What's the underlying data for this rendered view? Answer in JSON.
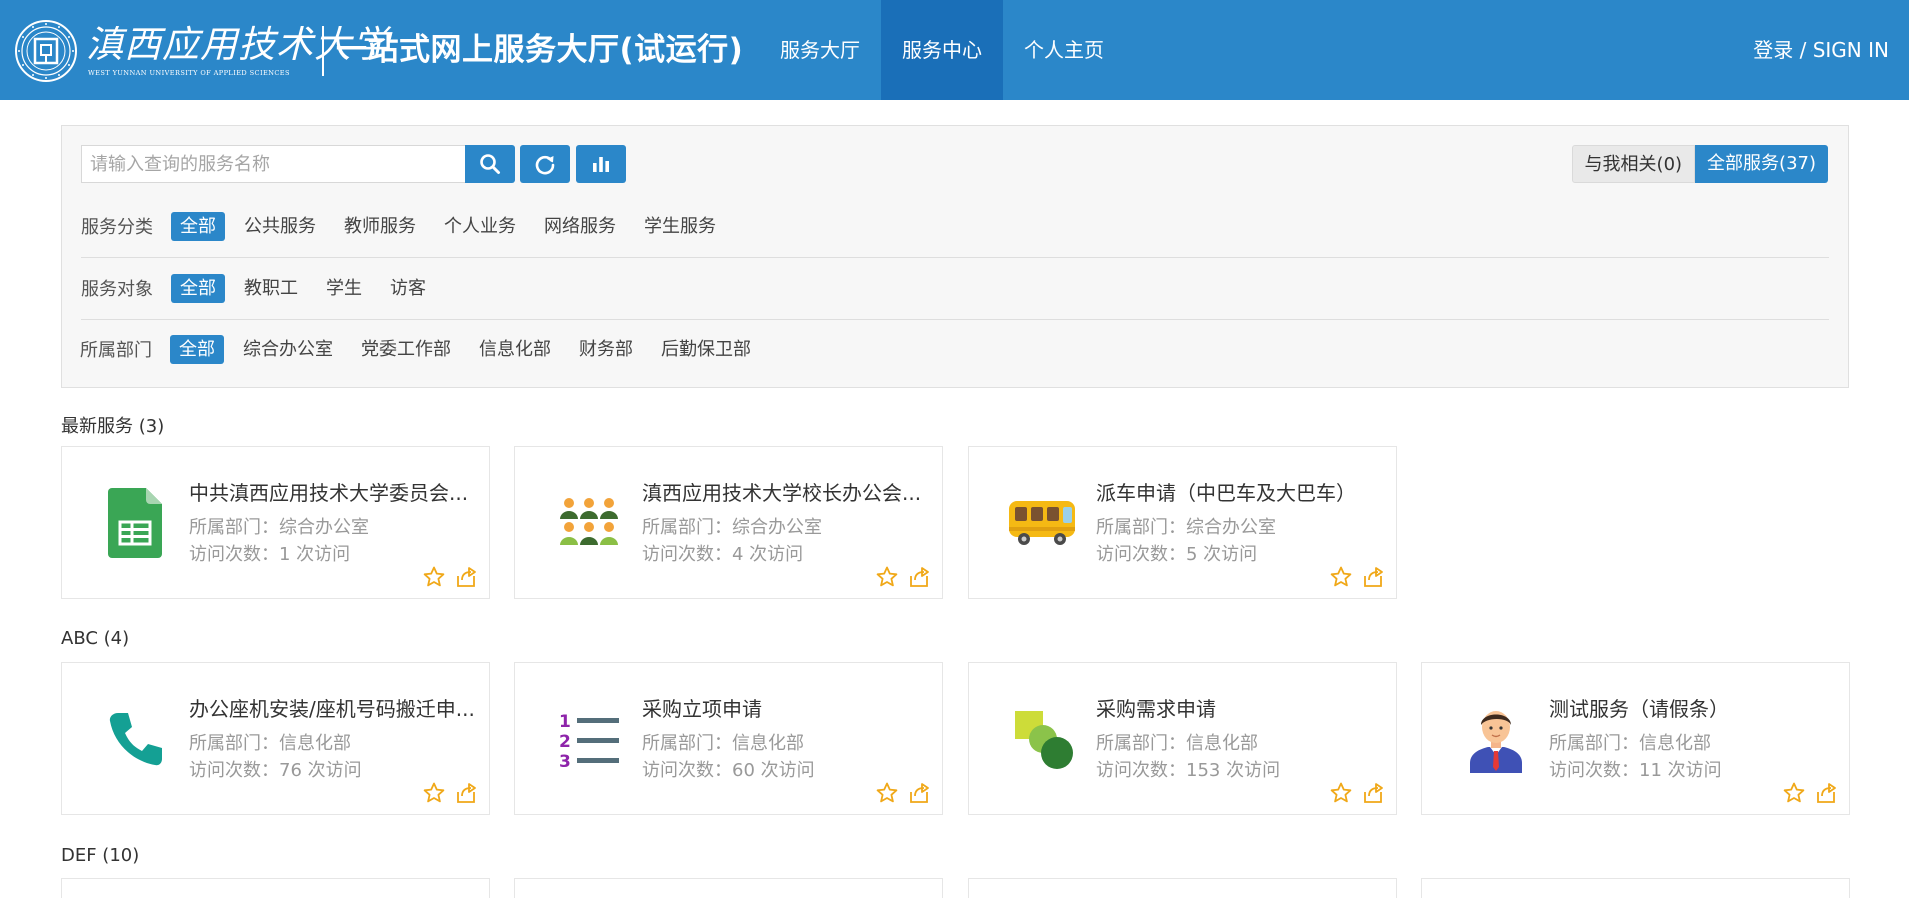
{
  "header": {
    "school_name_cn": "滇西应用技术大学",
    "school_name_en": "WEST YUNNAN UNIVERSITY OF APPLIED SCIENCES",
    "portal_title": "一站式网上服务大厅(试运行)",
    "nav": [
      {
        "label": "服务大厅",
        "active": false
      },
      {
        "label": "服务中心",
        "active": true
      },
      {
        "label": "个人主页",
        "active": false
      }
    ],
    "login_label": "登录 / SIGN IN"
  },
  "search": {
    "placeholder": "请输入查询的服务名称",
    "related_label": "与我相关(0)",
    "all_label": "全部服务(37)"
  },
  "filters": {
    "category": {
      "label": "服务分类",
      "options": [
        "全部",
        "公共服务",
        "教师服务",
        "个人业务",
        "网络服务",
        "学生服务"
      ],
      "selected": "全部"
    },
    "audience": {
      "label": "服务对象",
      "options": [
        "全部",
        "教职工",
        "学生",
        "访客"
      ],
      "selected": "全部"
    },
    "department": {
      "label": "所属部门",
      "options": [
        "全部",
        "综合办公室",
        "党委工作部",
        "信息化部",
        "财务部",
        "后勤保卫部"
      ],
      "selected": "全部"
    }
  },
  "sections": [
    {
      "title": "最新服务 (3)",
      "cards": [
        {
          "title": "中共滇西应用技术大学委员会...",
          "dept": "所属部门：综合办公室",
          "visits": "访问次数：1 次访问",
          "icon": "spreadsheet-icon"
        },
        {
          "title": "滇西应用技术大学校长办公会...",
          "dept": "所属部门：综合办公室",
          "visits": "访问次数：4 次访问",
          "icon": "meeting-group-icon"
        },
        {
          "title": "派车申请（中巴车及大巴车）",
          "dept": "所属部门：综合办公室",
          "visits": "访问次数：5 次访问",
          "icon": "bus-icon"
        }
      ]
    },
    {
      "title": "ABC (4)",
      "cards": [
        {
          "title": "办公座机安装/座机号码搬迁申...",
          "dept": "所属部门：信息化部",
          "visits": "访问次数：76 次访问",
          "icon": "phone-icon"
        },
        {
          "title": "采购立项申请",
          "dept": "所属部门：信息化部",
          "visits": "访问次数：60 次访问",
          "icon": "numbered-list-icon"
        },
        {
          "title": "采购需求申请",
          "dept": "所属部门：信息化部",
          "visits": "访问次数：153 次访问",
          "icon": "shapes-icon"
        },
        {
          "title": "测试服务（请假条）",
          "dept": "所属部门：信息化部",
          "visits": "访问次数：11 次访问",
          "icon": "person-icon"
        }
      ]
    },
    {
      "title": "DEF (10)",
      "cards": []
    }
  ],
  "colors": {
    "primary": "#2b87c9",
    "nav_active": "#1a6fb8",
    "star": "#f0a818"
  }
}
